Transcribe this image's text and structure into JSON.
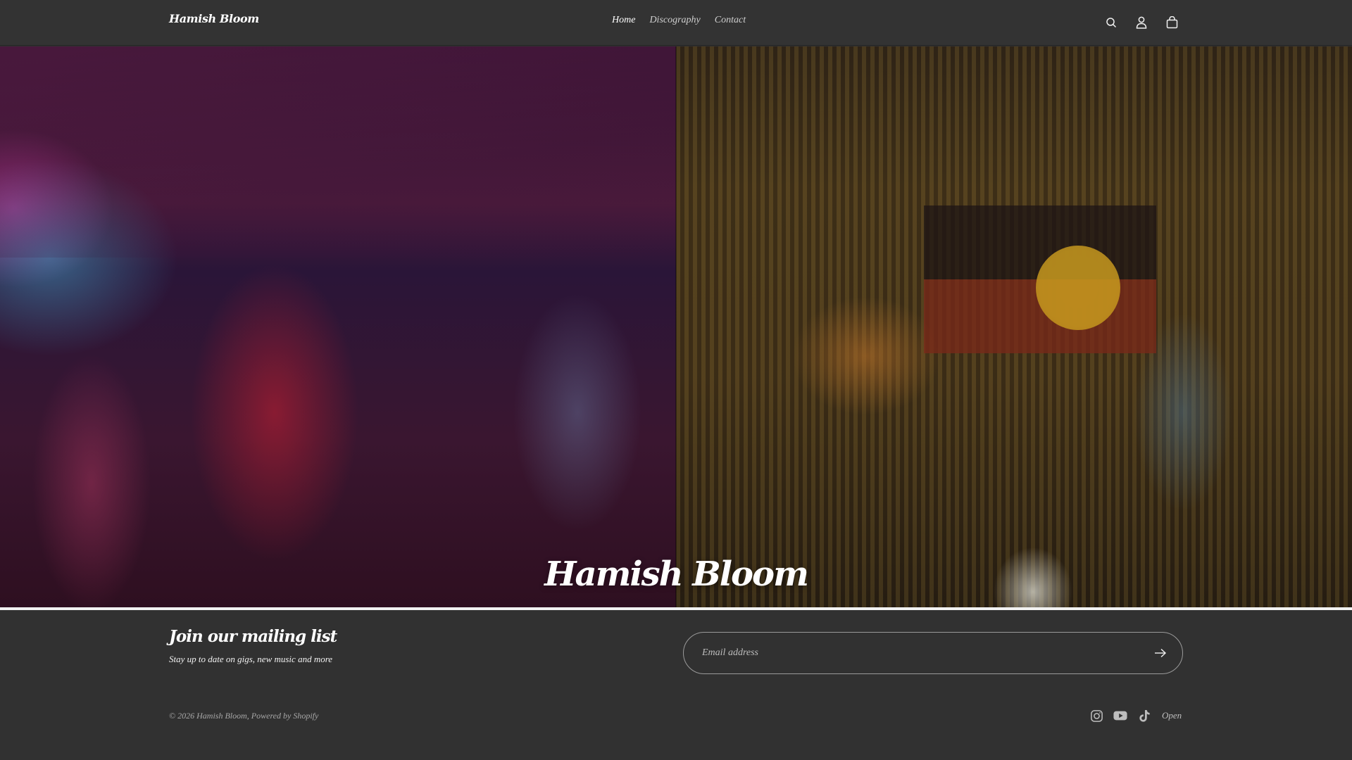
{
  "header": {
    "brand": "Hamish Bloom",
    "nav": [
      {
        "label": "Home",
        "active": true
      },
      {
        "label": "Discography",
        "active": false
      },
      {
        "label": "Contact",
        "active": false
      }
    ],
    "icons": [
      "search-icon",
      "account-icon",
      "cart-icon"
    ]
  },
  "hero": {
    "title": "Hamish Bloom"
  },
  "mailing": {
    "heading": "Join our mailing list",
    "subheading": "Stay up to date on gigs, new music and more",
    "email_placeholder": "Email address",
    "submit_icon": "arrow-right-icon"
  },
  "footer": {
    "copyright_prefix": "© 2026 ",
    "copyright_brand": "Hamish Bloom",
    "copyright_sep": ", ",
    "powered_by": "Powered by Shopify",
    "socials": [
      "instagram-icon",
      "youtube-icon",
      "tiktok-icon"
    ],
    "open_label": "Open"
  },
  "colors": {
    "header_bg": "#333333",
    "footer_bg": "#313131",
    "text": "#ffffff"
  }
}
